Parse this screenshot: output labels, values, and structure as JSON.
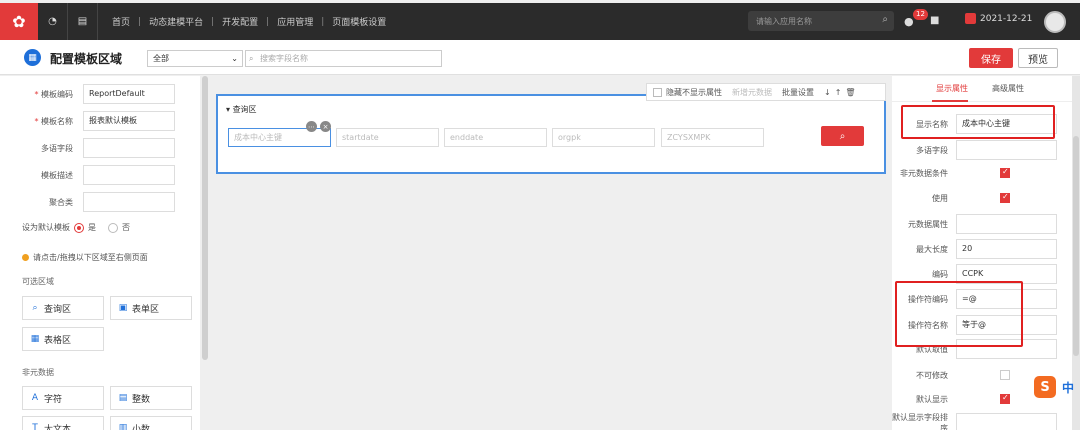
{
  "topnav": {
    "breadcrumb": [
      "首页",
      "动态建模平台",
      "开发配置",
      "应用管理",
      "页面模板设置"
    ],
    "search_placeholder": "请输入应用名称",
    "notification_count": "12",
    "date": "2021-12-21"
  },
  "header": {
    "title": "配置模板区域",
    "select_value": "全部",
    "field_search_placeholder": "搜索字段名称",
    "save_label": "保存",
    "preview_label": "预览"
  },
  "left": {
    "fields": [
      {
        "label": "模板编码",
        "required": true,
        "value": "ReportDefault"
      },
      {
        "label": "模板名称",
        "required": true,
        "value": "报表默认模板"
      },
      {
        "label": "多语字段",
        "required": false,
        "value": ""
      },
      {
        "label": "模板描述",
        "required": false,
        "value": ""
      },
      {
        "label": "聚合类",
        "required": false,
        "value": ""
      }
    ],
    "default_label": "设为默认模板",
    "radio_yes": "是",
    "radio_no": "否",
    "hint": "请点击/拖拽以下区域至右侧页面",
    "section_areas": "可选区域",
    "areas": [
      "查询区",
      "表单区",
      "表格区"
    ],
    "section_nonmeta": "非元数据",
    "nonmeta": [
      "字符",
      "整数",
      "大文本",
      "小数"
    ]
  },
  "center": {
    "toolbar": {
      "hide_label": "隐藏不显示属性",
      "add_meta": "新增元数据",
      "batch": "批量设置"
    },
    "query_zone_title": "查询区",
    "query_fields": [
      "成本中心主键",
      "startdate",
      "enddate",
      "orgpk",
      "ZCYSXMPK"
    ]
  },
  "right": {
    "tab_display": "显示属性",
    "tab_advanced": "高级属性",
    "props": [
      {
        "label": "显示名称",
        "type": "input",
        "value": "成本中心主键"
      },
      {
        "label": "多语字段",
        "type": "input",
        "value": ""
      },
      {
        "label": "非元数据条件",
        "type": "check",
        "checked": true
      },
      {
        "label": "使用",
        "type": "check",
        "checked": true
      },
      {
        "label": "元数据属性",
        "type": "input",
        "value": ""
      },
      {
        "label": "最大长度",
        "type": "input",
        "value": "20"
      },
      {
        "label": "编码",
        "type": "input",
        "value": "CCPK"
      },
      {
        "label": "操作符编码",
        "type": "input",
        "value": "=@"
      },
      {
        "label": "操作符名称",
        "type": "input",
        "value": "等于@"
      },
      {
        "label": "默认取值",
        "type": "input",
        "value": ""
      },
      {
        "label": "不可修改",
        "type": "check",
        "checked": false
      },
      {
        "label": "默认显示",
        "type": "check",
        "checked": true
      },
      {
        "label": "默认显示字段排序",
        "type": "input",
        "value": ""
      }
    ]
  },
  "ime": {
    "logo": "S",
    "mode": "中"
  },
  "colors": {
    "accent": "#e23a3a",
    "focus": "#4a90e2",
    "nav": "#2b2b2b"
  }
}
